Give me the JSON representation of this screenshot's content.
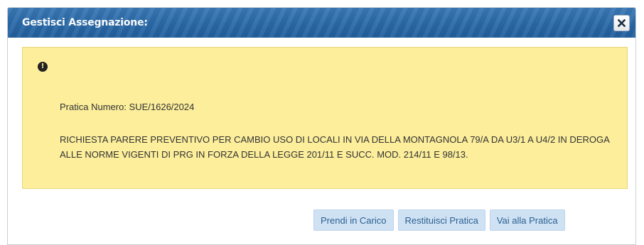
{
  "dialog": {
    "title": "Gestisci Assegnazione:",
    "close_icon": "close-icon"
  },
  "alert": {
    "icon": "exclamation-circle-icon",
    "pratica_line": "Pratica Numero: SUE/1626/2024",
    "description": "RICHIESTA PARERE PREVENTIVO PER CAMBIO USO DI LOCALI IN VIA DELLA MONTAGNOLA 79/A DA U3/1 A U4/2 IN DEROGA ALLE NORME VIGENTI DI PRG IN FORZA DELLA LEGGE 201/11 E SUCC. MOD. 214/11 E 98/13."
  },
  "actions": {
    "take_charge": "Prendi in Carico",
    "return_practice": "Restituisci Pratica",
    "go_to_practice": "Vai alla Pratica"
  },
  "colors": {
    "titlebar": "#2b6aa8",
    "alert_bg": "#fcee9b",
    "button_bg": "#cfe2f4",
    "button_text": "#2c5f8f"
  }
}
